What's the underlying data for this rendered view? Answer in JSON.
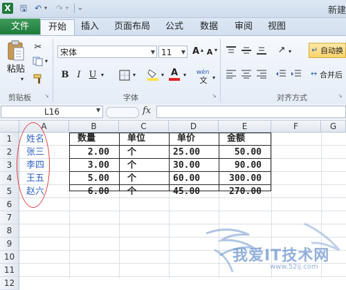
{
  "window": {
    "title": "新建"
  },
  "quick_access": {
    "app_icon": "excel-logo",
    "app_icon_letter": "X",
    "save_icon": "save-icon",
    "undo_icon": "undo-icon",
    "redo_icon": "redo-icon"
  },
  "tabs": [
    {
      "label": "文件"
    },
    {
      "label": "开始"
    },
    {
      "label": "插入"
    },
    {
      "label": "页面布局"
    },
    {
      "label": "公式"
    },
    {
      "label": "数据"
    },
    {
      "label": "审阅"
    },
    {
      "label": "视图"
    }
  ],
  "ribbon": {
    "paste_label": "粘贴",
    "clipboard_label": "剪贴板",
    "font_name": "宋体",
    "font_size": "11",
    "font_group_label": "字体",
    "alignment_group_label": "对齐方式",
    "wrap_text_label": "自动换",
    "merge_label": "合并后",
    "bold": "B",
    "italic": "I",
    "underline": "U",
    "grow_font": "A",
    "shrink_font": "A",
    "font_color": "A",
    "phonetic": "wén"
  },
  "formula_bar": {
    "name_box": "L16",
    "fx_label": "fx",
    "formula": ""
  },
  "columns": [
    "A",
    "B",
    "C",
    "D",
    "E",
    "F",
    "G"
  ],
  "rows": [
    "1",
    "2",
    "3",
    "4",
    "5",
    "6",
    "7",
    "8",
    "9",
    "10",
    "11",
    "12"
  ],
  "sheet": {
    "name_column": [
      "姓名",
      "张三",
      "李四",
      "王五",
      "赵六"
    ],
    "table": [
      [
        "数量",
        "单位",
        "单价",
        "金额"
      ],
      [
        "2.00",
        "个",
        "25.00",
        "50.00"
      ],
      [
        "3.00",
        "个",
        "30.00",
        "90.00"
      ],
      [
        "5.00",
        "个",
        "60.00",
        "300.00"
      ],
      [
        "6.00",
        "个",
        "45.00",
        "270.00"
      ]
    ]
  },
  "watermark": {
    "text": "我爱IT技术网",
    "url": "www.52ij.com"
  },
  "colors": {
    "accent_green": "#1e7a3c",
    "highlight_oval": "#e03a3a",
    "name_text": "#2f63c8"
  }
}
